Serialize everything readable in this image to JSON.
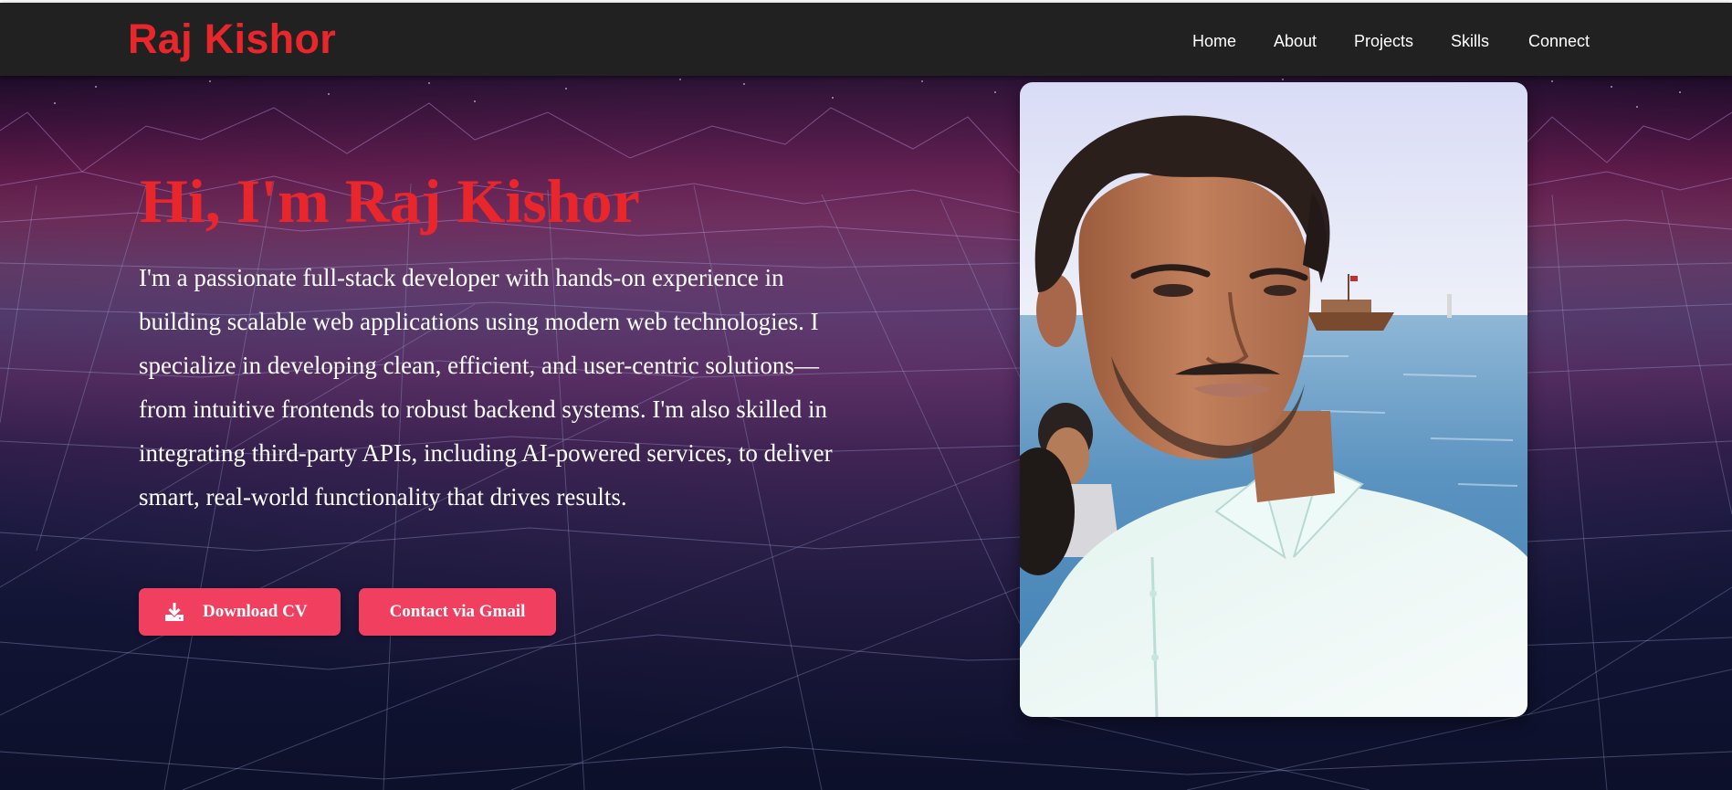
{
  "navbar": {
    "brand": "Raj Kishor",
    "links": [
      {
        "label": "Home"
      },
      {
        "label": "About"
      },
      {
        "label": "Projects"
      },
      {
        "label": "Skills"
      },
      {
        "label": "Connect"
      }
    ]
  },
  "hero": {
    "title": "Hi, I'm Raj Kishor",
    "bio": "I'm a passionate full-stack developer with hands-on experience in building scalable web applications using modern web technologies. I specialize in developing clean, efficient, and user-centric solutions—from intuitive frontends to robust backend systems. I'm also skilled in integrating third-party APIs, including AI-powered services, to deliver smart, real-world functionality that drives results.",
    "buttons": {
      "download_cv": {
        "label": "Download CV",
        "icon": "download-icon"
      },
      "contact_gmail": {
        "label": "Contact via Gmail"
      }
    }
  },
  "colors": {
    "brand_red": "#e8262b",
    "button_pink": "#f13f5f",
    "navbar_bg": "#212121",
    "hero_bg_dark": "#0d102a",
    "hero_bg_magenta": "#6a2a55"
  }
}
